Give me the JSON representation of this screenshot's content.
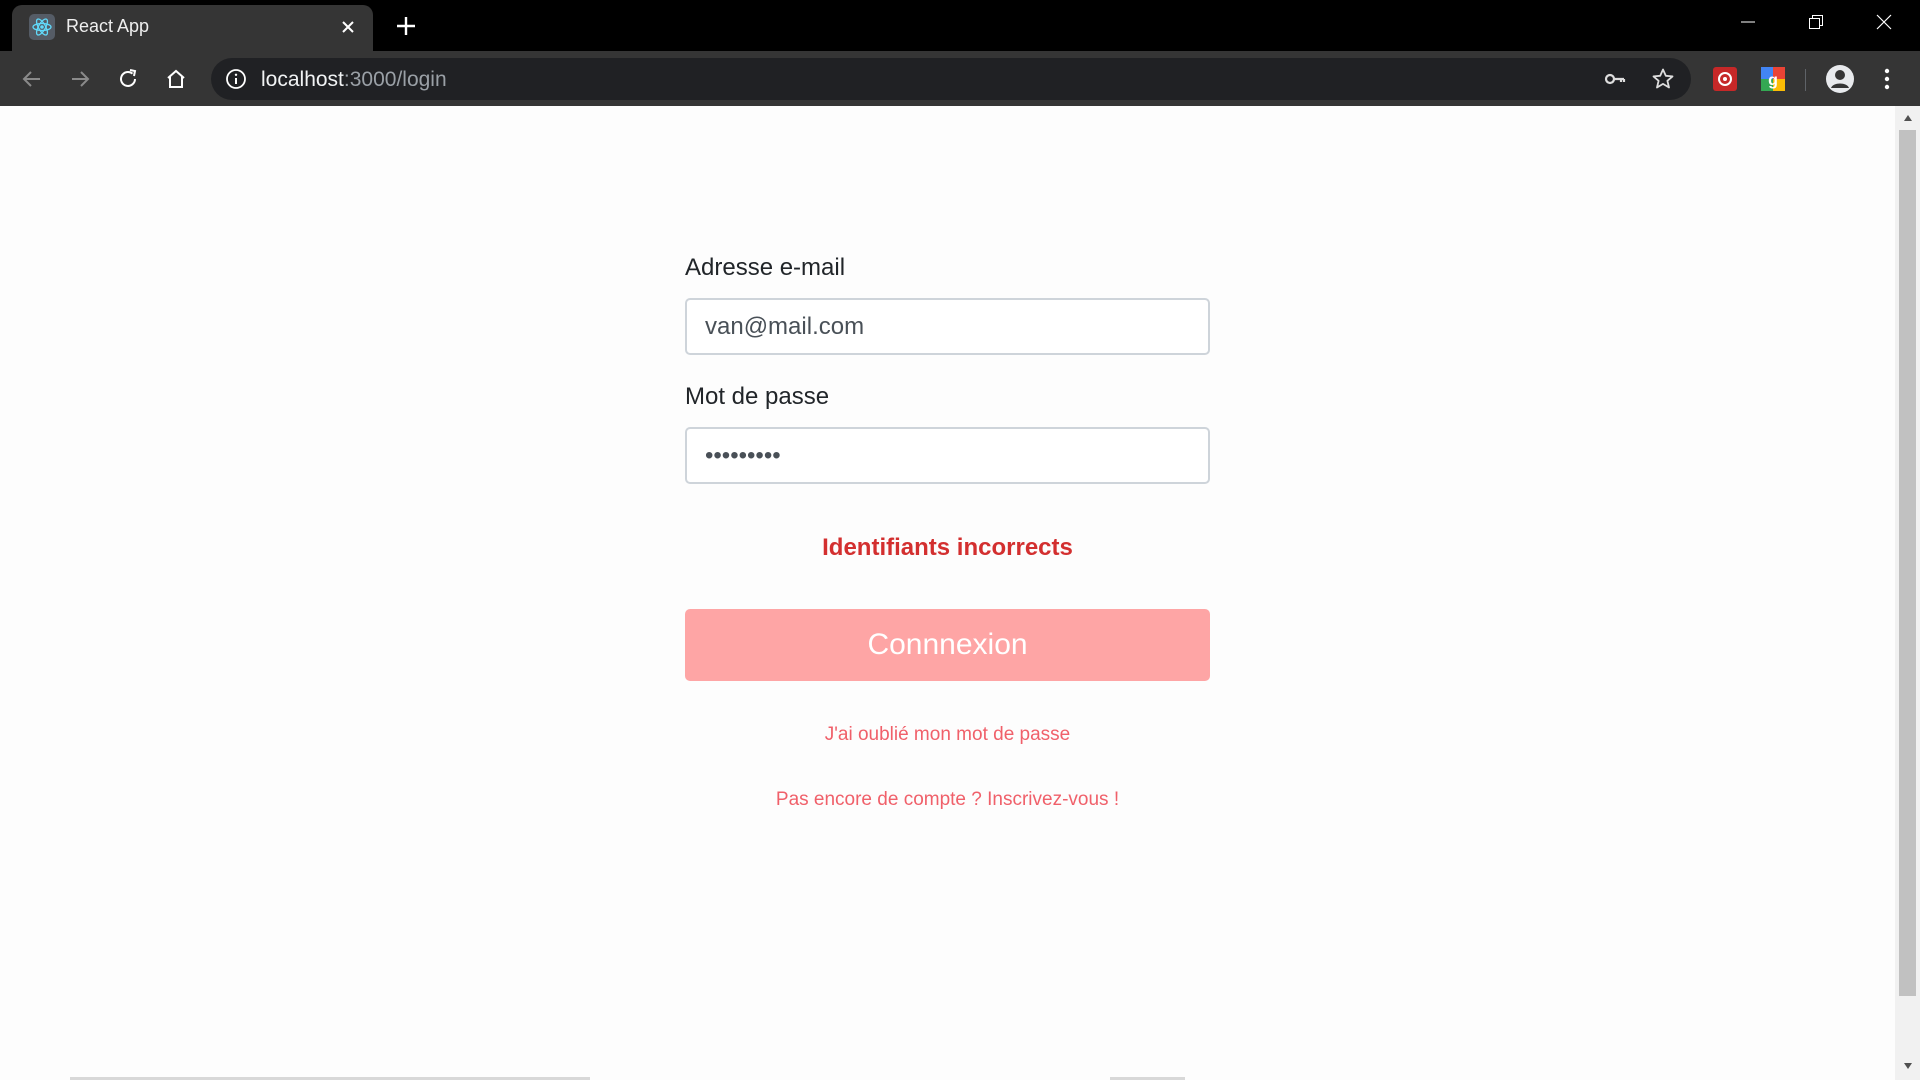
{
  "browser": {
    "tab_title": "React App",
    "url_host": "localhost",
    "url_path": ":3000/login",
    "accent": "#61dafb"
  },
  "login_form": {
    "email_label": "Adresse e-mail",
    "email_value": "van@mail.com",
    "password_label": "Mot de passe",
    "password_value": "password1",
    "error_message": "Identifiants incorrects",
    "submit_label": "Connnexion",
    "forgot_password_link": "J'ai oublié mon mot de passe",
    "signup_link": "Pas encore de compte ? Inscrivez-vous !"
  },
  "colors": {
    "error": "#d32f2f",
    "button_bg": "#fea5a5",
    "link": "#f0606a"
  },
  "icons": [
    "react-logo-icon",
    "close-icon",
    "plus-icon",
    "minimize-icon",
    "restore-icon",
    "window-close-icon",
    "back-arrow-icon",
    "forward-arrow-icon",
    "reload-icon",
    "home-icon",
    "info-icon",
    "key-icon",
    "star-icon",
    "extension-icon",
    "account-icon",
    "menu-dots-icon"
  ]
}
